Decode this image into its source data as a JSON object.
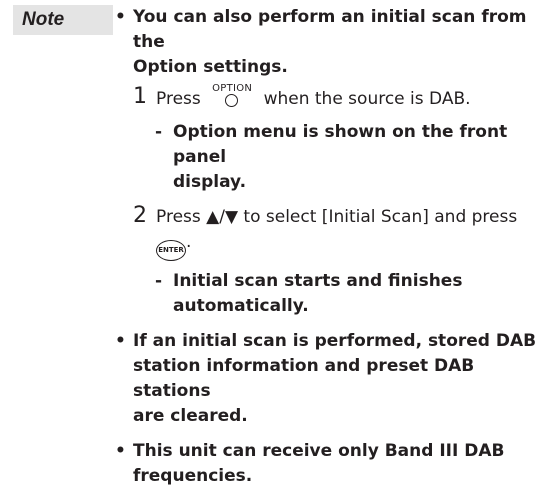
{
  "note_label": "Note",
  "bullets": {
    "b1": {
      "line1": "You can also perform an initial scan from the",
      "line2": "Option settings."
    },
    "b2": {
      "line1": "If an initial scan is performed, stored DAB",
      "line2": "station information and preset DAB stations",
      "line3": "are cleared."
    },
    "b3": {
      "line1": "This unit can receive only Band III DAB",
      "line2": "frequencies."
    }
  },
  "steps": {
    "s1": {
      "num": "1",
      "before": "Press",
      "after": "when the source is DAB."
    },
    "s2": {
      "num": "2",
      "line1": "Press ▲/▼ to select [Initial Scan] and press",
      "after": "."
    }
  },
  "subs": {
    "r1": {
      "line1": "Option menu is shown on the front panel",
      "line2": "display."
    },
    "r2": {
      "line1": "Initial scan starts and finishes",
      "line2": "automatically."
    }
  },
  "icons": {
    "option_button": {
      "name": "option-button-icon",
      "label": "OPTION"
    },
    "enter_button": {
      "name": "enter-button-icon",
      "label": "ENTER"
    }
  },
  "symbols": {
    "bullet": "•",
    "dash": "-"
  }
}
